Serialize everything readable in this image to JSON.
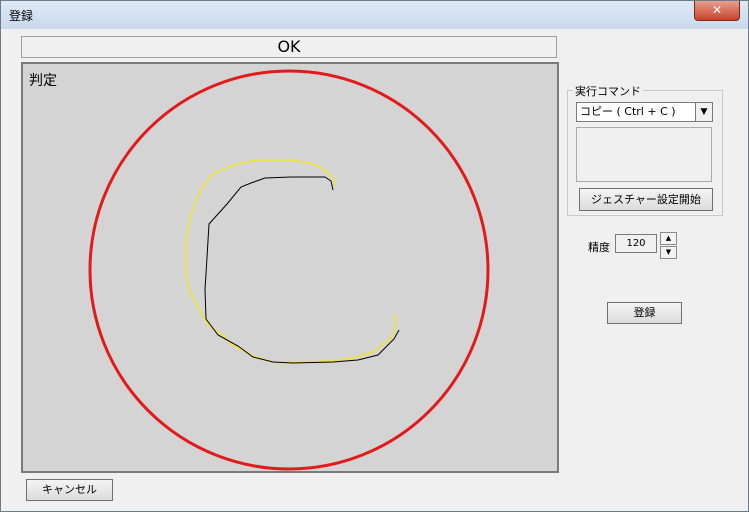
{
  "window": {
    "title": "登録",
    "close_label": "✕"
  },
  "status": {
    "text": "OK"
  },
  "canvas": {
    "label": "判定",
    "circle_color": "#e11b1b",
    "stroke_yellow": "#f4e32a",
    "stroke_black": "#000000"
  },
  "command": {
    "group_label": "実行コマンド",
    "selected": "コピー ( Ctrl + C )",
    "gesture_button_label": "ジェスチャー設定開始"
  },
  "precision": {
    "label": "精度",
    "value": "120"
  },
  "actions": {
    "register_label": "登録",
    "cancel_label": "キャンセル"
  }
}
